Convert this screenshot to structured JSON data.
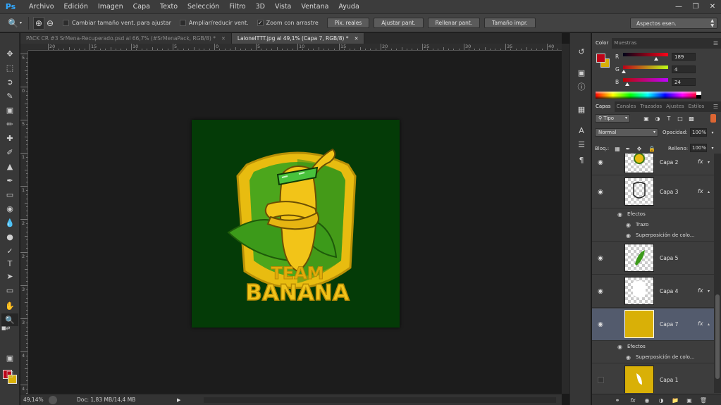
{
  "app": {
    "logo": "Ps"
  },
  "menu": [
    "Archivo",
    "Edición",
    "Imagen",
    "Capa",
    "Texto",
    "Selección",
    "Filtro",
    "3D",
    "Vista",
    "Ventana",
    "Ayuda"
  ],
  "window_controls": [
    "minimize-icon",
    "restore-icon",
    "close-icon"
  ],
  "options": {
    "check_resize": {
      "label": "Cambiar tamaño vent. para ajustar",
      "checked": false
    },
    "check_zoom_all": {
      "label": "Ampliar/reducir vent.",
      "checked": false
    },
    "check_scrubby": {
      "label": "Zoom con arrastre",
      "checked": true
    },
    "buttons": [
      "Píx. reales",
      "Ajustar pant.",
      "Rellenar pant.",
      "Tamaño impr."
    ],
    "workspace": "Aspectos esen."
  },
  "tabs": [
    {
      "label": "PACK CR #3 SrMena-Recuperado.psd al 66,7% (#SrMenaPack, RGB/8) *",
      "active": false
    },
    {
      "label": "LaionelTTT.jpg al 49,1% (Capa 7, RGB/8) *",
      "active": true
    }
  ],
  "rulers": {
    "horizontal": [
      "20",
      "15",
      "10",
      "5",
      "0",
      "5",
      "10",
      "15",
      "20",
      "25",
      "30",
      "35",
      "40"
    ],
    "vertical": [
      "5",
      "0",
      "5",
      "1",
      "1",
      "2",
      "2",
      "3",
      "3",
      "4",
      "4"
    ]
  },
  "artwork": {
    "line1": "TEAM",
    "line2": "BANANA"
  },
  "status": {
    "zoom": "49,14%",
    "doc": "Doc: 1,83 MB/14,4 MB"
  },
  "colors": {
    "foreground": "#bd0418",
    "background": "#d9b007",
    "canvas_bg": "#043b07",
    "selected_layer_bg": "#535b6d"
  },
  "color_panel": {
    "tabs": [
      "Color",
      "Muestras"
    ],
    "sliders": [
      {
        "label": "R",
        "value": "189",
        "level": 0.74
      },
      {
        "label": "G",
        "value": "4",
        "level": 0.02
      },
      {
        "label": "B",
        "value": "24",
        "level": 0.09
      }
    ]
  },
  "layers_panel": {
    "tabs": [
      "Capas",
      "Canales",
      "Trazados",
      "Ajustes",
      "Estilos"
    ],
    "filter": "Tipo",
    "blend_mode": "Normal",
    "opacity_label": "Opacidad:",
    "opacity": "100%",
    "lock_label": "Bloq.:",
    "fill_label": "Relleno:",
    "fill": "100%",
    "layers": [
      {
        "name": "Capa 2",
        "visible": true,
        "fx": true
      },
      {
        "name": "Capa 3",
        "visible": true,
        "fx": true,
        "effects_label": "Efectos",
        "effects": [
          "Trazo",
          "Superposición de colo..."
        ]
      },
      {
        "name": "Capa 5",
        "visible": true,
        "fx": false
      },
      {
        "name": "Capa 4",
        "visible": true,
        "fx": true
      },
      {
        "name": "Capa 7",
        "visible": true,
        "fx": true,
        "selected": true,
        "effects_label": "Efectos",
        "effects": [
          "Superposición de colo..."
        ]
      },
      {
        "name": "Capa 1",
        "visible": false,
        "fx": false
      }
    ],
    "fx_label": "fx"
  }
}
